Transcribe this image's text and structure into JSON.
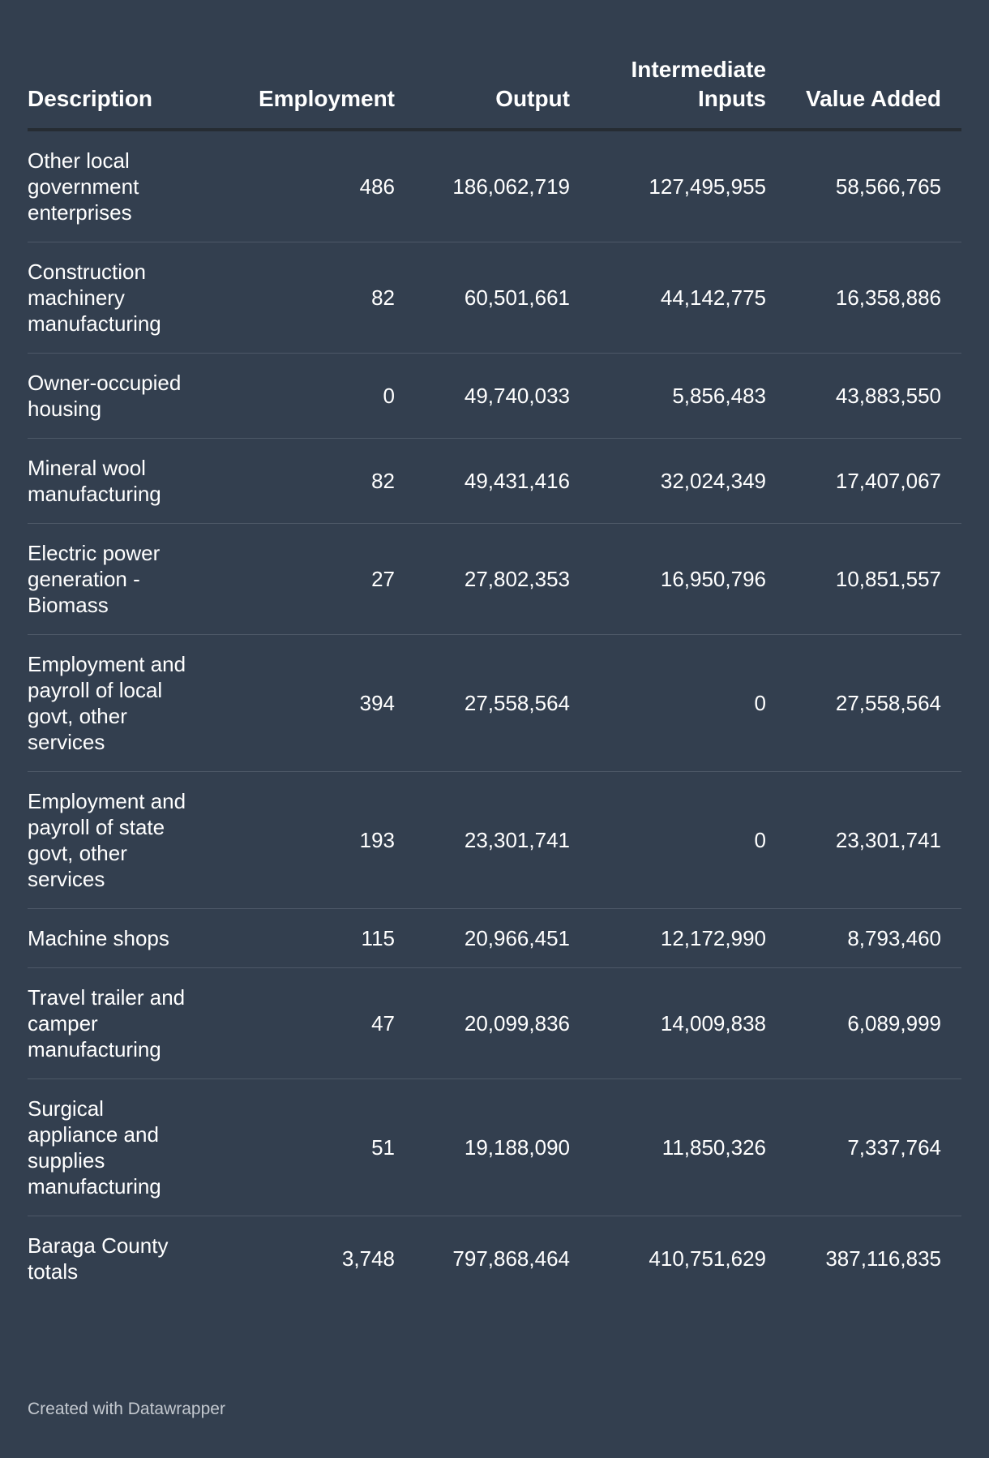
{
  "chart_data": {
    "type": "table",
    "columns": [
      "Description",
      "Employment",
      "Output",
      "Intermediate Inputs",
      "Value Added"
    ],
    "rows": [
      {
        "description": "Other local government enterprises",
        "employment": "486",
        "output": "186,062,719",
        "intermediate_inputs": "127,495,955",
        "value_added": "58,566,765"
      },
      {
        "description": "Construction machinery manufacturing",
        "employment": "82",
        "output": "60,501,661",
        "intermediate_inputs": "44,142,775",
        "value_added": "16,358,886"
      },
      {
        "description": "Owner-occupied housing",
        "employment": "0",
        "output": "49,740,033",
        "intermediate_inputs": "5,856,483",
        "value_added": "43,883,550"
      },
      {
        "description": "Mineral wool manufacturing",
        "employment": "82",
        "output": "49,431,416",
        "intermediate_inputs": "32,024,349",
        "value_added": "17,407,067"
      },
      {
        "description": "Electric power generation - Biomass",
        "employment": "27",
        "output": "27,802,353",
        "intermediate_inputs": "16,950,796",
        "value_added": "10,851,557"
      },
      {
        "description": "Employment and payroll of local govt, other services",
        "employment": "394",
        "output": "27,558,564",
        "intermediate_inputs": "0",
        "value_added": "27,558,564"
      },
      {
        "description": "Employment and payroll of state govt, other services",
        "employment": "193",
        "output": "23,301,741",
        "intermediate_inputs": "0",
        "value_added": "23,301,741"
      },
      {
        "description": "Machine shops",
        "employment": "115",
        "output": "20,966,451",
        "intermediate_inputs": "12,172,990",
        "value_added": "8,793,460"
      },
      {
        "description": "Travel trailer and camper manufacturing",
        "employment": "47",
        "output": "20,099,836",
        "intermediate_inputs": "14,009,838",
        "value_added": "6,089,999"
      },
      {
        "description": "Surgical appliance and supplies manufacturing",
        "employment": "51",
        "output": "19,188,090",
        "intermediate_inputs": "11,850,326",
        "value_added": "7,337,764"
      },
      {
        "description": "Baraga County totals",
        "employment": "3,748",
        "output": "797,868,464",
        "intermediate_inputs": "410,751,629",
        "value_added": "387,116,835"
      }
    ]
  },
  "footer": {
    "credit": "Created with Datawrapper"
  },
  "colors": {
    "background": "#333f4f",
    "text": "#ffffff",
    "header_rule": "#262c33",
    "row_rule": "#4d5867",
    "footer_text": "#c3c8cf"
  }
}
